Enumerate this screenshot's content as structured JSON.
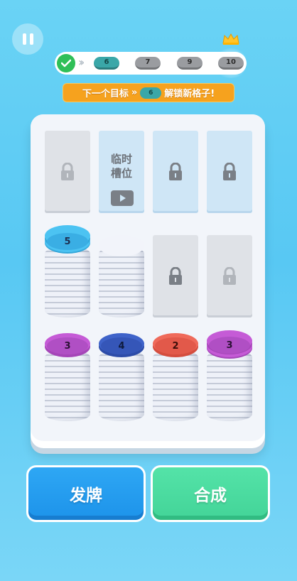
{
  "hud": {
    "progress_levels": [
      "6",
      "7",
      "9",
      "10"
    ],
    "banner": {
      "prefix": "下一个目标",
      "chip": "6",
      "suffix": "解锁新格子!"
    }
  },
  "board": {
    "temp_slot_label_line1": "临时",
    "temp_slot_label_line2": "槽位",
    "stacks": [
      {
        "value": "5",
        "color": "#4cc3f2",
        "face": "#2f9fd7",
        "text_color": "#1d2d4f"
      },
      {
        "value": "",
        "color": "#eef1f8",
        "face": "#eef1f8",
        "text_color": "#333333"
      },
      {
        "value": "3",
        "color": "#c55bd6",
        "face": "#9a3fb4",
        "text_color": "#2a1033"
      },
      {
        "value": "4",
        "color": "#3f63c9",
        "face": "#2f4aa3",
        "text_color": "#0e1a3d"
      },
      {
        "value": "2",
        "color": "#ef6a5a",
        "face": "#d84a3c",
        "text_color": "#3a0d08"
      },
      {
        "value": "3",
        "color": "#c55bd6",
        "face": "#9a3fb4",
        "text_color": "#2a1033"
      }
    ]
  },
  "buttons": {
    "deal_label": "发牌",
    "merge_label": "合成"
  },
  "colors": {
    "background": "#5ecbf4",
    "deal_button": "#2ea7f4",
    "merge_button": "#54e3a8",
    "banner": "#f6a21e",
    "progress_done": "#2fbf57"
  }
}
